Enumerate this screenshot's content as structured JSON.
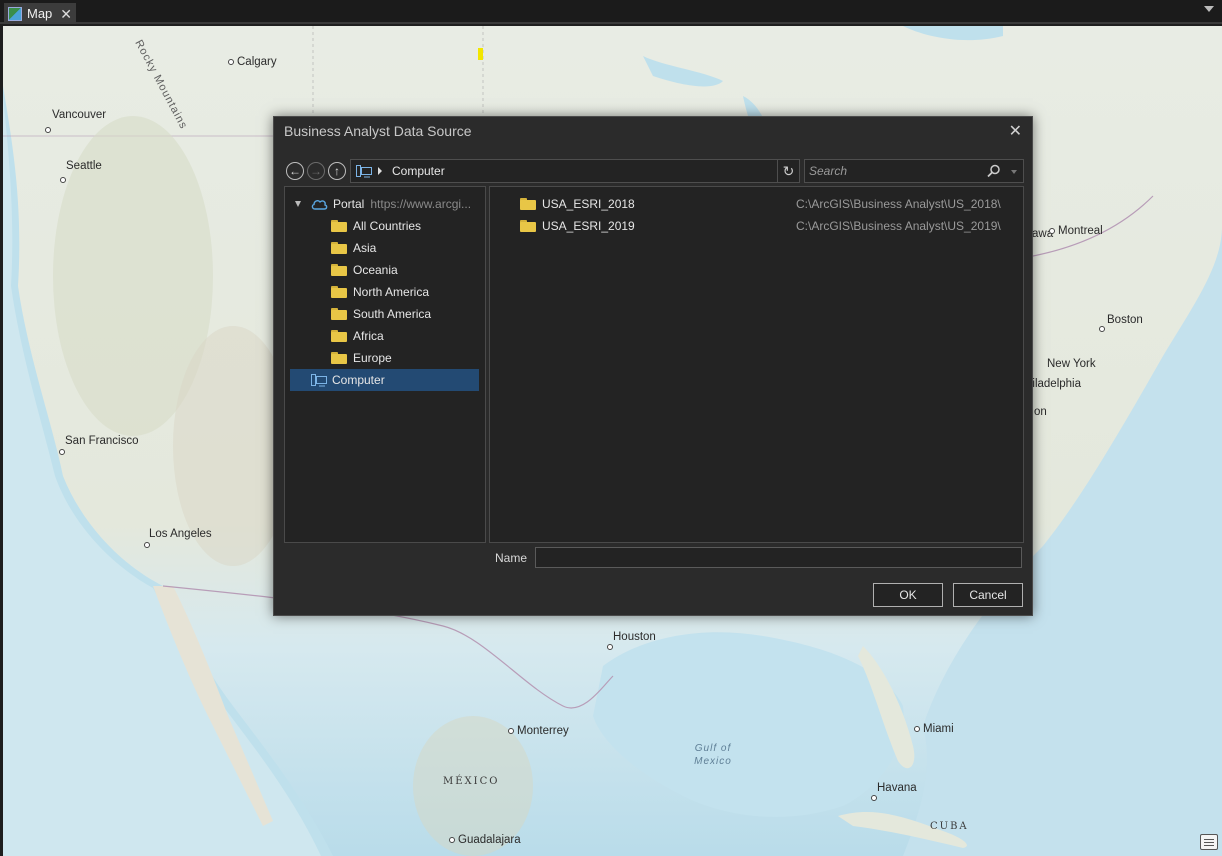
{
  "tab": {
    "label": "Map",
    "close": "✕"
  },
  "map": {
    "cities": [
      {
        "name": "Calgary",
        "id": "calgary"
      },
      {
        "name": "Vancouver",
        "id": "vancouver"
      },
      {
        "name": "Seattle",
        "id": "seattle"
      },
      {
        "name": "San Francisco",
        "id": "san-francisco"
      },
      {
        "name": "Los Angeles",
        "id": "los-angeles"
      },
      {
        "name": "Houston",
        "id": "houston"
      },
      {
        "name": "Monterrey",
        "id": "monterrey"
      },
      {
        "name": "Guadalajara",
        "id": "guadalajara"
      },
      {
        "name": "Miami",
        "id": "miami"
      },
      {
        "name": "Havana",
        "id": "havana"
      },
      {
        "name": "Montreal",
        "id": "montreal"
      },
      {
        "name": "Boston",
        "id": "boston"
      },
      {
        "name": "New York",
        "id": "new-york"
      }
    ],
    "partial_labels": {
      "ottawa": "awa",
      "philadelphia": "hiladelphia",
      "washington": "on"
    },
    "rocky_mountains": "Rocky Mountains",
    "gulf": "Gulf of\nMexico",
    "mexico": "MÉXICO",
    "cuba": "CUBA"
  },
  "dialog": {
    "title": "Business Analyst Data Source",
    "close": "✕",
    "nav": {
      "back": "←",
      "forward": "→",
      "up": "↑",
      "refresh": "↻"
    },
    "path": "Computer",
    "search_placeholder": "Search",
    "tree": {
      "portal_label": "Portal",
      "portal_url": "https://www.arcgi...",
      "folders": [
        "All Countries",
        "Asia",
        "Oceania",
        "North America",
        "South America",
        "Africa",
        "Europe"
      ],
      "computer_label": "Computer"
    },
    "files": [
      {
        "name": "USA_ESRI_2018",
        "path": "C:\\ArcGIS\\Business Analyst\\US_2018\\"
      },
      {
        "name": "USA_ESRI_2019",
        "path": "C:\\ArcGIS\\Business Analyst\\US_2019\\"
      }
    ],
    "name_label": "Name",
    "name_value": "",
    "ok_label": "OK",
    "cancel_label": "Cancel"
  },
  "colors": {
    "selection": "#234a73",
    "folder": "#e8c646",
    "dialog_bg": "#2b2b2b"
  }
}
